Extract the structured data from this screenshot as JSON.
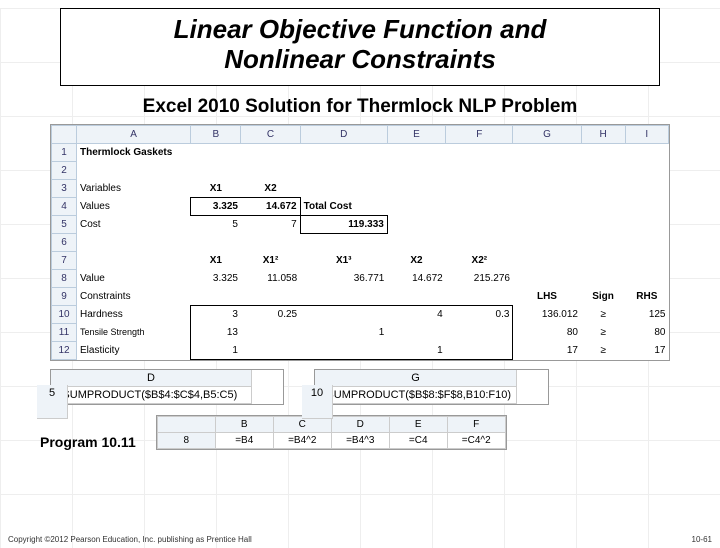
{
  "title_line1": "Linear Objective Function and",
  "title_line2": "Nonlinear Constraints",
  "subtitle": "Excel 2010 Solution for Thermlock  NLP Problem",
  "sheet": {
    "cols": [
      "A",
      "B",
      "C",
      "D",
      "E",
      "F",
      "G",
      "H",
      "I"
    ],
    "r1_A": "Thermlock Gaskets",
    "r3": {
      "A": "Variables",
      "B": "X1",
      "C": "X2"
    },
    "r4": {
      "A": "Values",
      "B": "3.325",
      "C": "14.672",
      "D": "Total Cost"
    },
    "r5": {
      "A": "Cost",
      "B": "5",
      "C": "7",
      "D": "119.333"
    },
    "r7": {
      "B": "X1",
      "C": "X1²",
      "D": "X1³",
      "E": "X2",
      "F": "X2²"
    },
    "r8": {
      "A": "Value",
      "B": "3.325",
      "C": "11.058",
      "D": "36.771",
      "E": "14.672",
      "F": "215.276"
    },
    "r9": {
      "A": "Constraints",
      "G": "LHS",
      "H": "Sign",
      "I": "RHS"
    },
    "r10": {
      "A": "Hardness",
      "B": "3",
      "C": "0.25",
      "E": "4",
      "F": "0.3",
      "G": "136.012",
      "H": "≥",
      "I": "125"
    },
    "r11": {
      "A": "Tensile Strength",
      "B": "13",
      "D": "1",
      "G": "80",
      "H": "≥",
      "I": "80"
    },
    "r12": {
      "A": "Elasticity",
      "B": "1",
      "E": "1",
      "G": "17",
      "H": "≥",
      "I": "17"
    }
  },
  "snip1": {
    "col": "D",
    "row": "5",
    "val": "=SUMPRODUCT($B$4:$C$4,B5:C5)"
  },
  "snip2": {
    "col": "G",
    "row": "10",
    "val": "=SUMPRODUCT($B$8:$F$8,B10:F10)"
  },
  "program_label": "Program 10.11",
  "snip3": {
    "cols": [
      "B",
      "C",
      "D",
      "E",
      "F"
    ],
    "row": "8",
    "vals": [
      "=B4",
      "=B4^2",
      "=B4^3",
      "=C4",
      "=C4^2"
    ]
  },
  "copyright": "Copyright ©2012 Pearson Education, Inc. publishing as Prentice Hall",
  "pagenum": "10-61"
}
